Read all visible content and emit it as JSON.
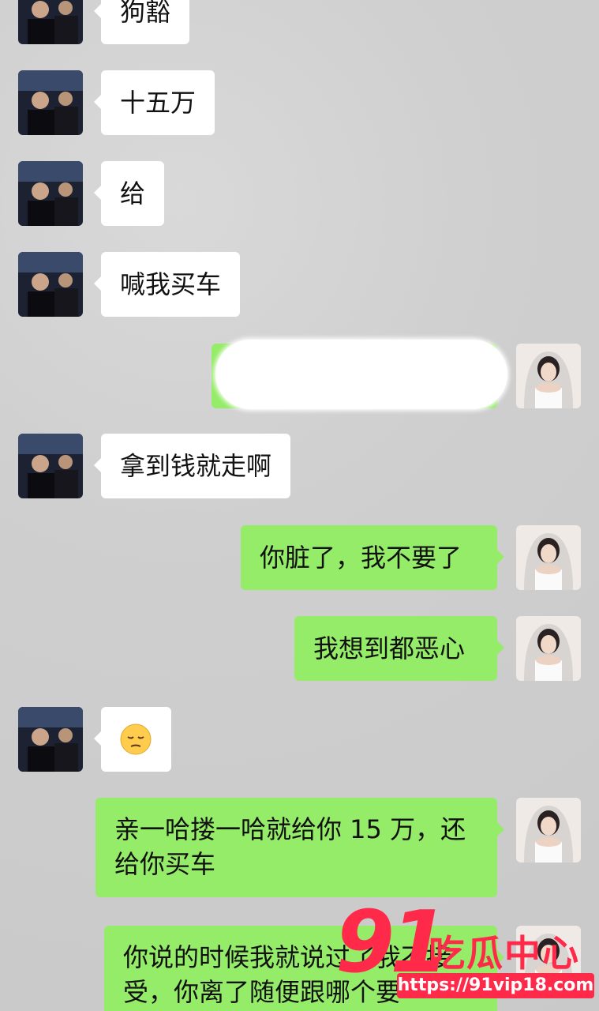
{
  "conversation": {
    "messages": [
      {
        "side": "left",
        "text": "狗豁"
      },
      {
        "side": "left",
        "text": "十五万"
      },
      {
        "side": "left",
        "text": "给"
      },
      {
        "side": "left",
        "text": "喊我买车"
      },
      {
        "side": "right",
        "text": "",
        "redacted": true
      },
      {
        "side": "left",
        "text": "拿到钱就走啊"
      },
      {
        "side": "right",
        "text": "你脏了，我不要了"
      },
      {
        "side": "right",
        "text": "我想到都恶心"
      },
      {
        "side": "left",
        "text": "😔"
      },
      {
        "side": "right",
        "text_line1": "亲一哈搂一哈就给你 15 万，还",
        "text_line2": "给你买车"
      },
      {
        "side": "right",
        "text_line1": "你说的时候我就说过了我不接",
        "text_line2": "受，你离了随便跟哪个要"
      }
    ]
  },
  "watermark": {
    "number": "91",
    "brand": "吃瓜中心",
    "url": "https://91vip18.com"
  },
  "colors": {
    "background": "#cccccc",
    "incoming_bubble": "#ffffff",
    "outgoing_bubble": "#95ec69",
    "watermark": "#ff2a4a"
  }
}
